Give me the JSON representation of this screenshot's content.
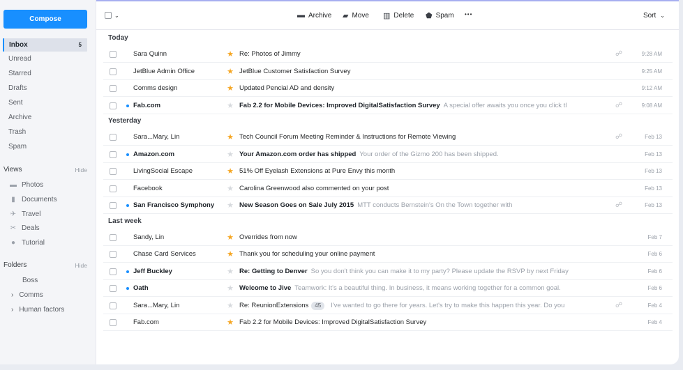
{
  "compose_label": "Compose",
  "folders": {
    "inbox": {
      "label": "Inbox",
      "count": "5"
    },
    "items": [
      "Unread",
      "Starred",
      "Drafts",
      "Sent",
      "Archive",
      "Trash",
      "Spam"
    ]
  },
  "views": {
    "title": "Views",
    "hide": "Hide",
    "items": [
      {
        "label": "Photos",
        "icon": "photos-icon"
      },
      {
        "label": "Documents",
        "icon": "documents-icon"
      },
      {
        "label": "Travel",
        "icon": "travel-icon"
      },
      {
        "label": "Deals",
        "icon": "deals-icon"
      },
      {
        "label": "Tutorial",
        "icon": "tutorial-icon"
      }
    ]
  },
  "user_folders": {
    "title": "Folders",
    "hide": "Hide",
    "items": [
      {
        "label": "Boss",
        "expandable": false
      },
      {
        "label": "Comms",
        "expandable": true
      },
      {
        "label": "Human factors",
        "expandable": true
      }
    ]
  },
  "toolbar": {
    "archive": "Archive",
    "move": "Move",
    "delete": "Delete",
    "spam": "Spam",
    "more": "•••",
    "sort": "Sort"
  },
  "groups": [
    {
      "label": "Today",
      "messages": [
        {
          "sender": "Sara Quinn",
          "starred": true,
          "subject": "Re: Photos of Jimmy",
          "preview": "",
          "attachment": true,
          "time": "9:28 AM",
          "unread": false
        },
        {
          "sender": "JetBlue Admin Office",
          "starred": true,
          "subject": "JetBlue Customer Satisfaction Survey",
          "preview": "",
          "attachment": false,
          "time": "9:25 AM",
          "unread": false
        },
        {
          "sender": "Comms design",
          "starred": true,
          "subject": "Updated Pencial AD and density",
          "preview": "",
          "attachment": false,
          "time": "9:12 AM",
          "unread": false
        },
        {
          "sender": "Fab.com",
          "starred": false,
          "subject": "Fab 2.2 for Mobile Devices: Improved DigitalSatisfaction Survey",
          "preview": "A special offer awaits you once you click tl",
          "attachment": true,
          "time": "9:08 AM",
          "unread": true
        }
      ]
    },
    {
      "label": "Yesterday",
      "messages": [
        {
          "sender": "Sara...Mary, Lin",
          "starred": true,
          "subject": "Tech Council Forum Meeting Reminder & Instructions for Remote Viewing",
          "preview": "",
          "attachment": true,
          "time": "Feb 13",
          "unread": false
        },
        {
          "sender": "Amazon.com",
          "starred": false,
          "subject": "Your Amazon.com order has shipped",
          "preview": "Your order of the Gizmo 200 has been shipped.",
          "attachment": false,
          "time": "Feb 13",
          "unread": true
        },
        {
          "sender": "LivingSocial Escape",
          "starred": true,
          "subject": "51% Off Eyelash Extensions at Pure Envy this month",
          "preview": "",
          "attachment": false,
          "time": "Feb 13",
          "unread": false
        },
        {
          "sender": "Facebook",
          "starred": false,
          "subject": "Carolina Greenwood also commented on your post",
          "preview": "",
          "attachment": false,
          "time": "Feb 13",
          "unread": false
        },
        {
          "sender": "San Francisco Symphony",
          "starred": false,
          "subject": "New Season Goes on Sale July 2015",
          "preview": "MTT conducts Bernstein's On the Town together with",
          "attachment": true,
          "time": "Feb 13",
          "unread": true
        }
      ]
    },
    {
      "label": "Last week",
      "messages": [
        {
          "sender": "Sandy, Lin",
          "starred": true,
          "subject": "Overrides from now",
          "preview": "",
          "attachment": false,
          "time": "Feb 7",
          "unread": false
        },
        {
          "sender": "Chase Card Services",
          "starred": true,
          "subject": "Thank you for scheduling your online payment",
          "preview": "",
          "attachment": false,
          "time": "Feb 6",
          "unread": false
        },
        {
          "sender": "Jeff Buckley",
          "starred": false,
          "subject": "Re: Getting to Denver",
          "preview": "So you don't think you can make it to my party? Please update the RSVP by next Friday",
          "attachment": false,
          "time": "Feb 6",
          "unread": true
        },
        {
          "sender": "Oath",
          "starred": false,
          "subject": "Welcome to Jive",
          "preview": "Teamwork: It's a beautiful thing. In business, it means working together for a common goal.",
          "attachment": false,
          "time": "Feb 6",
          "unread": true
        },
        {
          "sender": "Sara...Mary, Lin",
          "starred": false,
          "subject": "Re: ReunionExtensions",
          "badge": "45",
          "preview": "I've wanted to go there for years. Let's try to make this happen this year. Do you",
          "attachment": true,
          "time": "Feb 4",
          "unread": false
        },
        {
          "sender": "Fab.com",
          "starred": true,
          "subject": "Fab 2.2 for Mobile Devices: Improved DigitalSatisfaction Survey",
          "preview": "",
          "attachment": false,
          "time": "Feb 4",
          "unread": false
        }
      ]
    }
  ],
  "colors": {
    "accent": "#188fff",
    "star": "#f5a623"
  }
}
